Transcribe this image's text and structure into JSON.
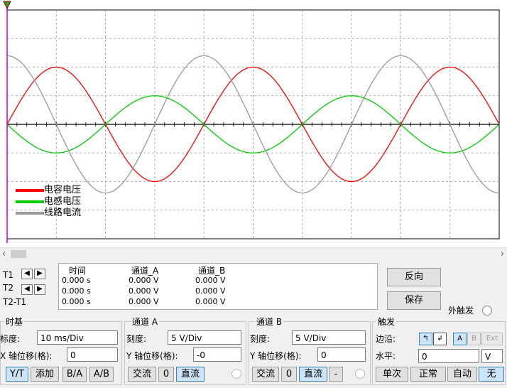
{
  "legend": [
    {
      "label": "电容电压",
      "color": "#ff0000"
    },
    {
      "label": "电感电压",
      "color": "#00cc00"
    },
    {
      "label": "线路电流",
      "color": "#999999"
    }
  ],
  "cursor_table": {
    "headers": [
      "时间",
      "通道_A",
      "通道_B"
    ],
    "rows": [
      {
        "label": "T1",
        "time": "0.000 s",
        "a": "0.000 V",
        "b": "0.000 V"
      },
      {
        "label": "T2",
        "time": "0.000 s",
        "a": "0.000 V",
        "b": "0.000 V"
      },
      {
        "label": "T2-T1",
        "time": "0.000 s",
        "a": "0.000 V",
        "b": "0.000 V"
      }
    ]
  },
  "buttons": {
    "reverse": "反向",
    "save": "保存",
    "ext_trigger": "外触发"
  },
  "timebase": {
    "title": "时基",
    "scale_label": "标度:",
    "scale_value": "10 ms/Div",
    "xpos_label": "X 轴位移(格):",
    "xpos_value": "0",
    "modes": [
      "Y/T",
      "添加",
      "B/A",
      "A/B"
    ]
  },
  "channel_a": {
    "title": "通道 A",
    "scale_label": "刻度:",
    "scale_value": "5  V/Div",
    "ypos_label": "Y 轴位移(格):",
    "ypos_value": "-0",
    "coupling": [
      "交流",
      "0",
      "直流"
    ]
  },
  "channel_b": {
    "title": "通道 B",
    "scale_label": "刻度:",
    "scale_value": "5  V/Div",
    "ypos_label": "Y 轴位移(格):",
    "ypos_value": "0",
    "coupling": [
      "交流",
      "0",
      "直流",
      "-"
    ]
  },
  "trigger": {
    "title": "触发",
    "edge_label": "边沿:",
    "edge_buttons": [
      "A",
      "B",
      "Ext"
    ],
    "level_label": "水平:",
    "level_value": "0",
    "level_unit": "V",
    "modes": [
      "单次",
      "正常",
      "自动",
      "无"
    ]
  },
  "chart_data": {
    "type": "line",
    "series": [
      {
        "name": "电容电压",
        "color": "#ff0000",
        "period_div": 4.0,
        "amplitude_div": 2.0,
        "phase": "sin"
      },
      {
        "name": "电感电压",
        "color": "#00cc00",
        "period_div": 4.0,
        "amplitude_div": 1.0,
        "phase": "-sin"
      },
      {
        "name": "线路电流",
        "color": "#999999",
        "period_div": 4.0,
        "amplitude_div": 2.4,
        "phase": "cos"
      }
    ],
    "grid": true,
    "x_divisions": 10,
    "y_divisions": 8
  },
  "colors": {
    "accent": "#3c7fb1",
    "trace_red": "#ff0000",
    "trace_green": "#00cc00",
    "trace_gray": "#999999"
  }
}
